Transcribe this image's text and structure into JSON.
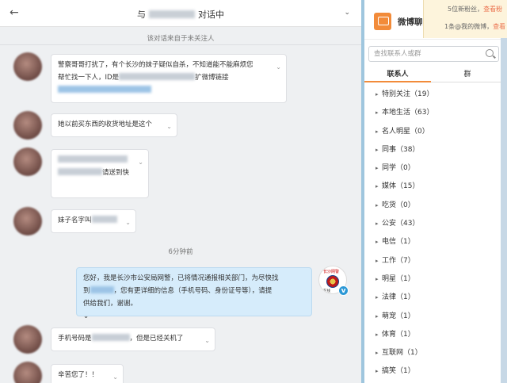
{
  "chat": {
    "title_prefix": "与",
    "title_suffix": "对话中",
    "subnote": "该对话来自于未关注人",
    "timestamp": "6分钟前",
    "messages": [
      {
        "line1": "警察哥哥打扰了，有个长沙的妹子疑似自杀，不知道能不能麻烦您",
        "line2a": "帮忙找一下人，ID是",
        "line2b": "扩微博链接"
      },
      {
        "text": "她以前买东西的收货地址是这个"
      },
      {
        "line2": "请送到快"
      },
      {
        "prefix": "妹子名字叫"
      },
      {
        "prefix": "手机号码是",
        "suffix": "，但是已经关机了"
      },
      {
        "text": "辛苦您了！！"
      }
    ],
    "reply": {
      "line1": "您好，我是长沙市公安局网警，已将情况通报相关部门，为尽快找",
      "line2a": "到",
      "line2b": "，您有更详细的信息（手机号码、身份证号等），请提",
      "line3": "供给我们，谢谢。"
    },
    "police_avatar_text": "长沙网警",
    "police_avatar_sub": "在线"
  },
  "sidepanel": {
    "title": "微博聊天助",
    "search_placeholder": "查找联系人或群",
    "tabs": [
      "联系人",
      "群"
    ],
    "groups": [
      "特别关注（19）",
      "本地生活（63）",
      "名人明星（0）",
      "同事（38）",
      "同学（0）",
      "媒体（15）",
      "吃货（0）",
      "公安（43）",
      "电信（1）",
      "工作（7）",
      "明星（1）",
      "法律（1）",
      "萌宠（1）",
      "体育（1）",
      "互联网（1）",
      "搞笑（1）"
    ]
  },
  "notify": {
    "line1_prefix": "5位新粉丝，",
    "line1_link": "查看粉",
    "line2_prefix": "1条@我的微博，",
    "line2_link": "查看"
  }
}
